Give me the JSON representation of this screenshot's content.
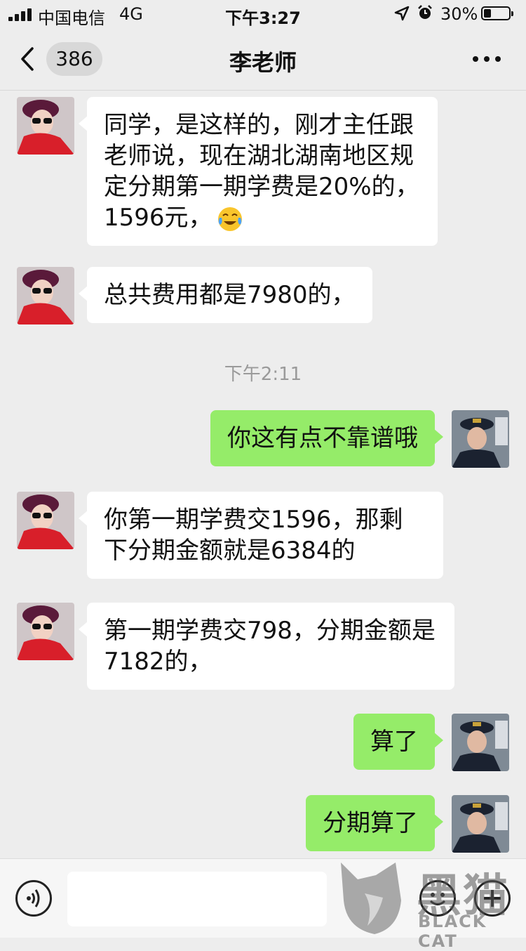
{
  "status_bar": {
    "carrier": "中国电信",
    "network": "4G",
    "time": "下午3:27",
    "battery": "30%",
    "battery_level": 0.3
  },
  "header": {
    "unread_count": "386",
    "title": "李老师"
  },
  "messages": [
    {
      "from": "teacher",
      "text": "同学，是这样的，刚才主任跟老师说，现在湖北湖南地区规定分期第一期学费是20%的，1596元，",
      "emoji": "face-with-tears-of-joy"
    },
    {
      "from": "teacher",
      "text": "总共费用都是7980的，"
    },
    {
      "from": "me",
      "text": "你这有点不靠谱哦"
    },
    {
      "from": "teacher",
      "text": "你第一期学费交1596，那剩下分期金额就是6384的"
    },
    {
      "from": "teacher",
      "text": "第一期学费交798，分期金额是7182的，"
    },
    {
      "from": "me",
      "text": "算了"
    },
    {
      "from": "me",
      "text": "分期算了"
    }
  ],
  "timestamp": "下午2:11",
  "input": {
    "placeholder": ""
  },
  "watermark": {
    "brand_cn": "黑猫",
    "brand_en": "BLACK CAT"
  },
  "colors": {
    "outgoing_bubble": "#95ec69",
    "incoming_bubble": "#ffffff",
    "background": "#ededed"
  }
}
